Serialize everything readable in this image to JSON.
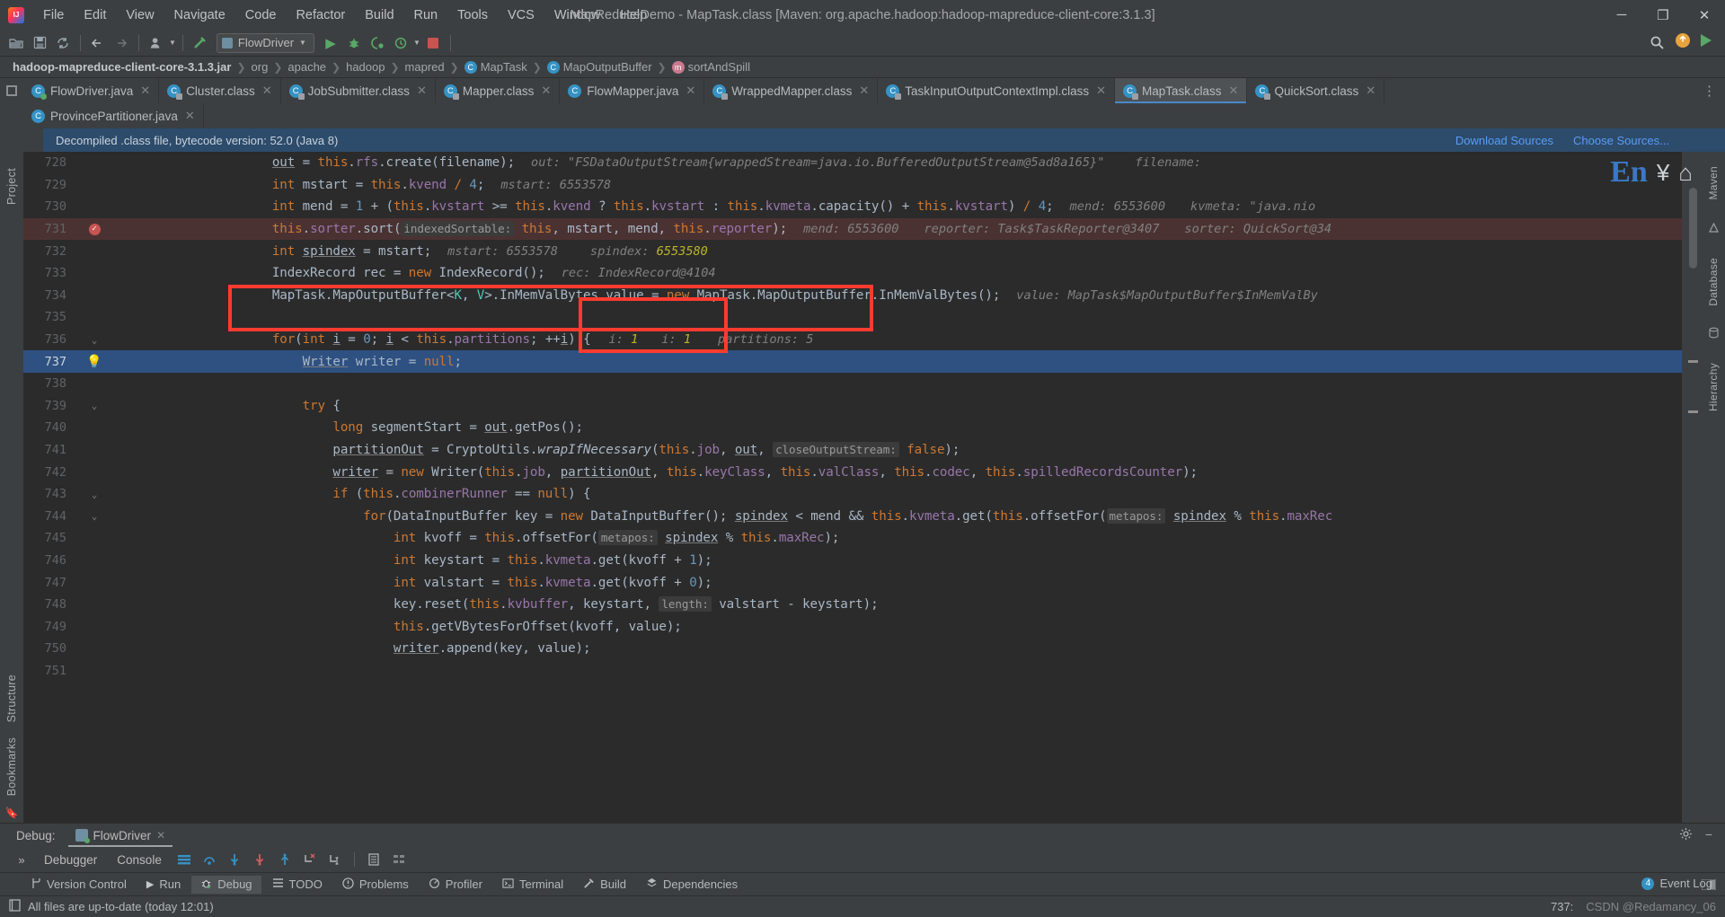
{
  "window": {
    "title": "MapReduceDemo - MapTask.class [Maven: org.apache.hadoop:hadoop-mapreduce-client-core:3.1.3]",
    "minimize": "─",
    "maximize": "❐",
    "close": "✕"
  },
  "menu": [
    {
      "label": "File"
    },
    {
      "label": "Edit"
    },
    {
      "label": "View"
    },
    {
      "label": "Navigate"
    },
    {
      "label": "Code"
    },
    {
      "label": "Refactor"
    },
    {
      "label": "Build"
    },
    {
      "label": "Run"
    },
    {
      "label": "Tools"
    },
    {
      "label": "VCS"
    },
    {
      "label": "Window"
    },
    {
      "label": "Help"
    }
  ],
  "toolbar": {
    "run_config": "FlowDriver",
    "icons": [
      "open-folder-icon",
      "save-icon",
      "sync-icon",
      "back-arrow-icon",
      "forward-arrow-icon",
      "profile-icon",
      "build-hammer-icon"
    ],
    "search_icon": "search-icon",
    "updates_icon": "updates-icon",
    "share_icon": "share-icon"
  },
  "breadcrumbs": [
    {
      "label": "hadoop-mapreduce-client-core-3.1.3.jar",
      "bold": true,
      "icon": null
    },
    {
      "label": "org",
      "bold": false,
      "icon": null
    },
    {
      "label": "apache",
      "bold": false,
      "icon": null
    },
    {
      "label": "hadoop",
      "bold": false,
      "icon": null
    },
    {
      "label": "mapred",
      "bold": false,
      "icon": null
    },
    {
      "label": "MapTask",
      "bold": false,
      "icon": "C"
    },
    {
      "label": "MapOutputBuffer",
      "bold": false,
      "icon": "C"
    },
    {
      "label": "sortAndSpill",
      "bold": false,
      "icon": "m"
    }
  ],
  "tabs_row1": [
    {
      "label": "FlowDriver.java",
      "icon": "java-class-icon",
      "active": false,
      "run": true
    },
    {
      "label": "Cluster.class",
      "icon": "class-locked-icon",
      "active": false,
      "run": false
    },
    {
      "label": "JobSubmitter.class",
      "icon": "class-locked-icon",
      "active": false,
      "run": false
    },
    {
      "label": "Mapper.class",
      "icon": "class-locked-icon",
      "active": false,
      "run": false
    },
    {
      "label": "FlowMapper.java",
      "icon": "java-class-icon",
      "active": false,
      "run": false
    },
    {
      "label": "WrappedMapper.class",
      "icon": "class-locked-icon",
      "active": false,
      "run": false
    },
    {
      "label": "TaskInputOutputContextImpl.class",
      "icon": "class-locked-icon",
      "active": false,
      "run": false
    },
    {
      "label": "MapTask.class",
      "icon": "class-locked-icon",
      "active": true,
      "run": false
    },
    {
      "label": "QuickSort.class",
      "icon": "class-locked-icon",
      "active": false,
      "run": false
    }
  ],
  "tabs_row2": [
    {
      "label": "ProvincePartitioner.java",
      "icon": "java-class-icon",
      "active": false,
      "run": false
    }
  ],
  "notice": {
    "text": "Decompiled .class file, bytecode version: 52.0 (Java 8)",
    "download_sources": "Download Sources",
    "choose_sources": "Choose Sources..."
  },
  "left_tool_tabs": [
    "Project",
    "Structure",
    "Bookmarks"
  ],
  "right_tool_tabs": [
    "Maven",
    "Database",
    "Hierarchy"
  ],
  "ime": {
    "letters": "En",
    "glyph1": "¥",
    "glyph2": "⌂"
  },
  "code_lines": [
    {
      "n": "728",
      "indent": 0
    },
    {
      "n": "729",
      "indent": 0
    },
    {
      "n": "730",
      "indent": 0
    },
    {
      "n": "731",
      "indent": 0
    },
    {
      "n": "732",
      "indent": 0
    },
    {
      "n": "733",
      "indent": 0
    },
    {
      "n": "734",
      "indent": 0
    },
    {
      "n": "735",
      "indent": 0
    },
    {
      "n": "736",
      "indent": 0
    },
    {
      "n": "737",
      "indent": 0
    },
    {
      "n": "738",
      "indent": 0
    },
    {
      "n": "739",
      "indent": 0
    },
    {
      "n": "740",
      "indent": 0
    },
    {
      "n": "741",
      "indent": 0
    },
    {
      "n": "742",
      "indent": 0
    },
    {
      "n": "743",
      "indent": 0
    },
    {
      "n": "744",
      "indent": 0
    },
    {
      "n": "745",
      "indent": 0
    },
    {
      "n": "746",
      "indent": 0
    },
    {
      "n": "747",
      "indent": 0
    },
    {
      "n": "748",
      "indent": 0
    },
    {
      "n": "749",
      "indent": 0
    },
    {
      "n": "750",
      "indent": 0
    },
    {
      "n": "751",
      "indent": 0
    }
  ],
  "code_text": {
    "l728": "out = this.rfs.create(filename);",
    "l728_hint": "out: \"FSDataOutputStream{wrappedStream=java.io.BufferedOutputStream@5ad8a165}\"",
    "l728_hint2": "filename:",
    "l729": "int mstart = this.kvend / 4;",
    "l729_hint": "mstart: 6553578",
    "l730": "int mend = 1 + (this.kvstart >= this.kvend ? this.kvstart : this.kvmeta.capacity() + this.kvstart) / 4;",
    "l730_hint": "mend: 6553600",
    "l730_hint2": "kvmeta: \"java.nio",
    "l731": "this.sorter.sort( indexedSortable: this, mstart, mend, this.reporter);",
    "l731_hint": "mend: 6553600",
    "l731_hint2": "reporter: Task$TaskReporter@3407",
    "l731_hint3": "sorter: QuickSort@34",
    "l732": "int spindex = mstart;",
    "l732_hint": "mstart: 6553578",
    "l732_hint2": "spindex: 6553580",
    "l733": "IndexRecord rec = new IndexRecord();",
    "l733_hint": "rec: IndexRecord@4104",
    "l734": "MapTask.MapOutputBuffer<K, V>.InMemValBytes value = new MapTask.MapOutputBuffer.InMemValBytes();",
    "l734_hint": "value: MapTask$MapOutputBuffer$InMemValBy",
    "l736": "for(int i = 0; i < this.partitions; ++i) {",
    "l736_hint_i1": "i: 1",
    "l736_hint_i2": "i: 1",
    "l736_hint_partitions": "partitions: 5",
    "l737": "Writer writer = null;",
    "l739": "try {",
    "l740": "long segmentStart = out.getPos();",
    "l741": "partitionOut = CryptoUtils.wrapIfNecessary(this.job, out, closeOutputStream: false);",
    "l742": "writer = new Writer(this.job, partitionOut, this.keyClass, this.valClass, this.codec, this.spilledRecordsCounter);",
    "l743": "if (this.combinerRunner == null) {",
    "l744": "for(DataInputBuffer key = new DataInputBuffer(); spindex < mend && this.kvmeta.get(this.offsetFor( metapos: spindex % this.maxRec",
    "l745": "int kvoff = this.offsetFor( metapos: spindex % this.maxRec);",
    "l746": "int keystart = this.kvmeta.get(kvoff + 1);",
    "l747": "int valstart = this.kvmeta.get(kvoff + 0);",
    "l748": "key.reset(this.kvbuffer, keystart, length: valstart - keystart);",
    "l749": "this.getVBytesForOffset(kvoff, value);",
    "l750": "writer.append(key, value);"
  },
  "debug": {
    "label": "Debug:",
    "session": "FlowDriver",
    "close": "✕",
    "tabs": [
      "Debugger",
      "Console"
    ],
    "settings_icon": "gear-icon",
    "minimize_icon": "minimize-icon",
    "toolbar_icons": [
      "frames-icon",
      "step-over-icon",
      "step-into-icon",
      "force-step-into-icon",
      "step-out-icon",
      "drop-frame-icon",
      "run-to-cursor-icon",
      "evaluate-icon",
      "layout-icon"
    ]
  },
  "tool_windows": [
    {
      "label": "Version Control",
      "icon": "branch-icon",
      "active": false
    },
    {
      "label": "Run",
      "icon": "play-icon",
      "active": false
    },
    {
      "label": "Debug",
      "icon": "bug-icon",
      "active": true
    },
    {
      "label": "TODO",
      "icon": "list-icon",
      "active": false
    },
    {
      "label": "Problems",
      "icon": "warning-icon",
      "active": false
    },
    {
      "label": "Profiler",
      "icon": "profiler-icon",
      "active": false
    },
    {
      "label": "Terminal",
      "icon": "terminal-icon",
      "active": false
    },
    {
      "label": "Build",
      "icon": "hammer-icon",
      "active": false
    },
    {
      "label": "Dependencies",
      "icon": "dependencies-icon",
      "active": false
    }
  ],
  "status": {
    "message": "All files are up-to-date (today 12:01)",
    "caret": "737:",
    "event_log": "Event Log",
    "watermark": "CSDN @Redamancy_06"
  },
  "colors": {
    "accent": "#4a88c7",
    "keyword": "#cc7832",
    "number": "#6897bb",
    "field": "#9876aa",
    "string": "#6a8759",
    "hint": "#808080",
    "current_line": "#2f5182",
    "annotation_red": "#ff3b30",
    "notice_bg": "#2d4b6b"
  }
}
